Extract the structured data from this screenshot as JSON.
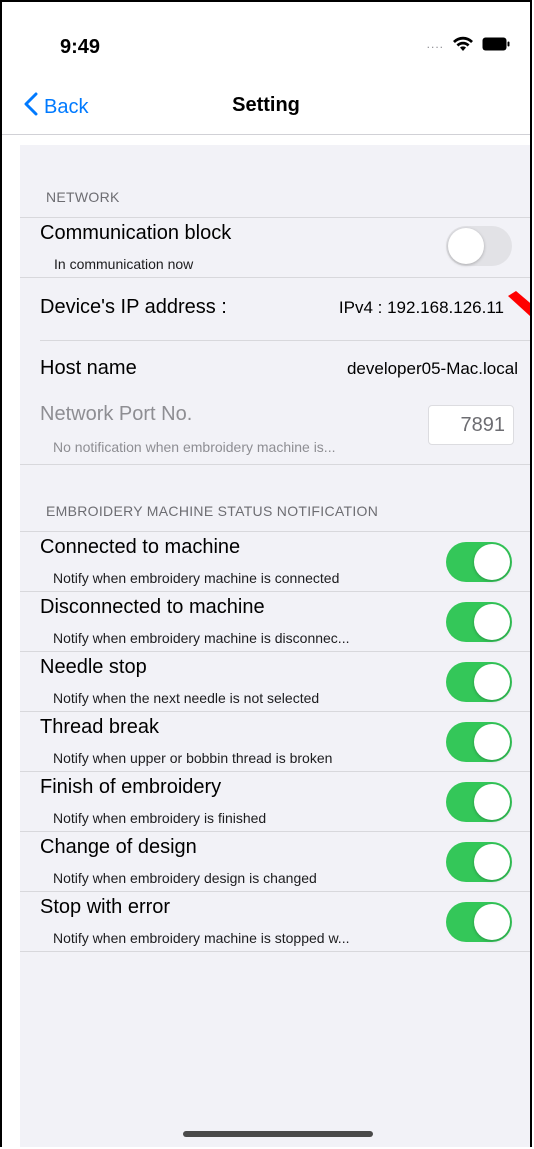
{
  "status": {
    "time": "9:49",
    "signal": "....",
    "wifi_icon": "wifi-icon",
    "battery_icon": "battery-icon"
  },
  "nav": {
    "back_label": "Back",
    "title": "Setting"
  },
  "network": {
    "header": "NETWORK",
    "comm_block": {
      "title": "Communication block",
      "subtitle": "In communication now",
      "enabled": false
    },
    "ip": {
      "label": "Device's IP address :",
      "value": "IPv4 : 192.168.126.11"
    },
    "host": {
      "label": "Host name",
      "value": "developer05-Mac.local"
    },
    "port": {
      "label": "Network Port No.",
      "subtitle": "No notification when embroidery machine is...",
      "value": "7891"
    }
  },
  "notifications": {
    "header": "EMBROIDERY MACHINE STATUS NOTIFICATION",
    "items": [
      {
        "title": "Connected to machine",
        "subtitle": "Notify when embroidery machine is connected",
        "enabled": true
      },
      {
        "title": "Disconnected to machine",
        "subtitle": "Notify when embroidery machine is disconnec...",
        "enabled": true
      },
      {
        "title": "Needle stop",
        "subtitle": "Notify when the next needle is not selected",
        "enabled": true
      },
      {
        "title": "Thread break",
        "subtitle": "Notify when upper or bobbin thread is broken",
        "enabled": true
      },
      {
        "title": "Finish of embroidery",
        "subtitle": "Notify when embroidery is finished",
        "enabled": true
      },
      {
        "title": "Change of design",
        "subtitle": "Notify when embroidery design is changed",
        "enabled": true
      },
      {
        "title": "Stop with error",
        "subtitle": "Notify when embroidery machine is stopped w...",
        "enabled": true
      }
    ]
  },
  "colors": {
    "accent": "#007aff",
    "toggle_on": "#34c759",
    "annotation_arrow": "#ff0000"
  }
}
